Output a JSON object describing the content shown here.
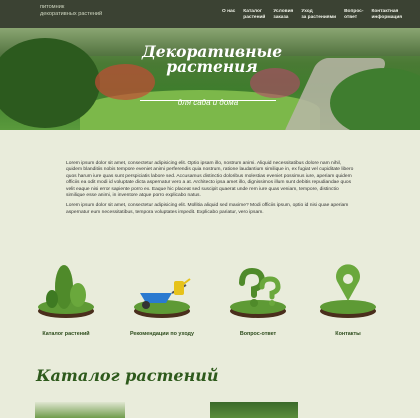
{
  "header": {
    "logo_line1": "питомник",
    "logo_line2": "декоративных растений",
    "nav": [
      {
        "line1": "О нас",
        "line2": ""
      },
      {
        "line1": "Каталог",
        "line2": "растений"
      },
      {
        "line1": "Условия",
        "line2": "заказа"
      },
      {
        "line1": "Уход",
        "line2": "за растениями"
      },
      {
        "line1": "Вопрос-",
        "line2": "ответ"
      },
      {
        "line1": "Контактная",
        "line2": "информация"
      }
    ]
  },
  "hero": {
    "title": "Декоративные растения",
    "subtitle": "для сада и дома"
  },
  "intro": {
    "p1": "Lorem ipsum dolor sit amet, consectetur adipisicing elit. Optio ipsam illo, nostrum animi. Aliquid necessitatibus dolore nam nihil, quidem blanditiis nobis tempore eveniet animi perferendis quia nostrum, ratione laudantium similique in, ex fugiat vel cupiditate libero quos harum iure quas sunt perspiciatis labore sed. Accusamus distinctio doloribus molestias eveniet possimus iure, aperiam quidem officiis ea odit modi id voluptate dicta aspernatur vero a at. Architecto ipsa amet illo, dignissimos illum sunt debitis repudiandae quos velit eaque nisi error sapiente porro ex. Eaque hic placeat sed suscipit quaerat unde rem iure quas veniam, tempore, distinctio similique esse animi, in inventore atque porro explicabo natus.",
    "p2": "Lorem ipsum dolor sit amet, consectetur adipisicing elit. Mollitia aliquid sed maxime? Modi officiis ipsum, optio id nisi quae aperiam aspernatur eum necessitatibus, tempora voluptates impedit. Explicabo pariatur, vero ipsam."
  },
  "categories": [
    {
      "label": "Каталог растений",
      "icon": "topiary-trees-icon"
    },
    {
      "label": "Рекомендации по уходу",
      "icon": "wheelbarrow-icon"
    },
    {
      "label": "Вопрос-ответ",
      "icon": "question-topiary-icon"
    },
    {
      "label": "Контакты",
      "icon": "location-pin-icon"
    }
  ],
  "catalog": {
    "title": "Каталог растений"
  }
}
